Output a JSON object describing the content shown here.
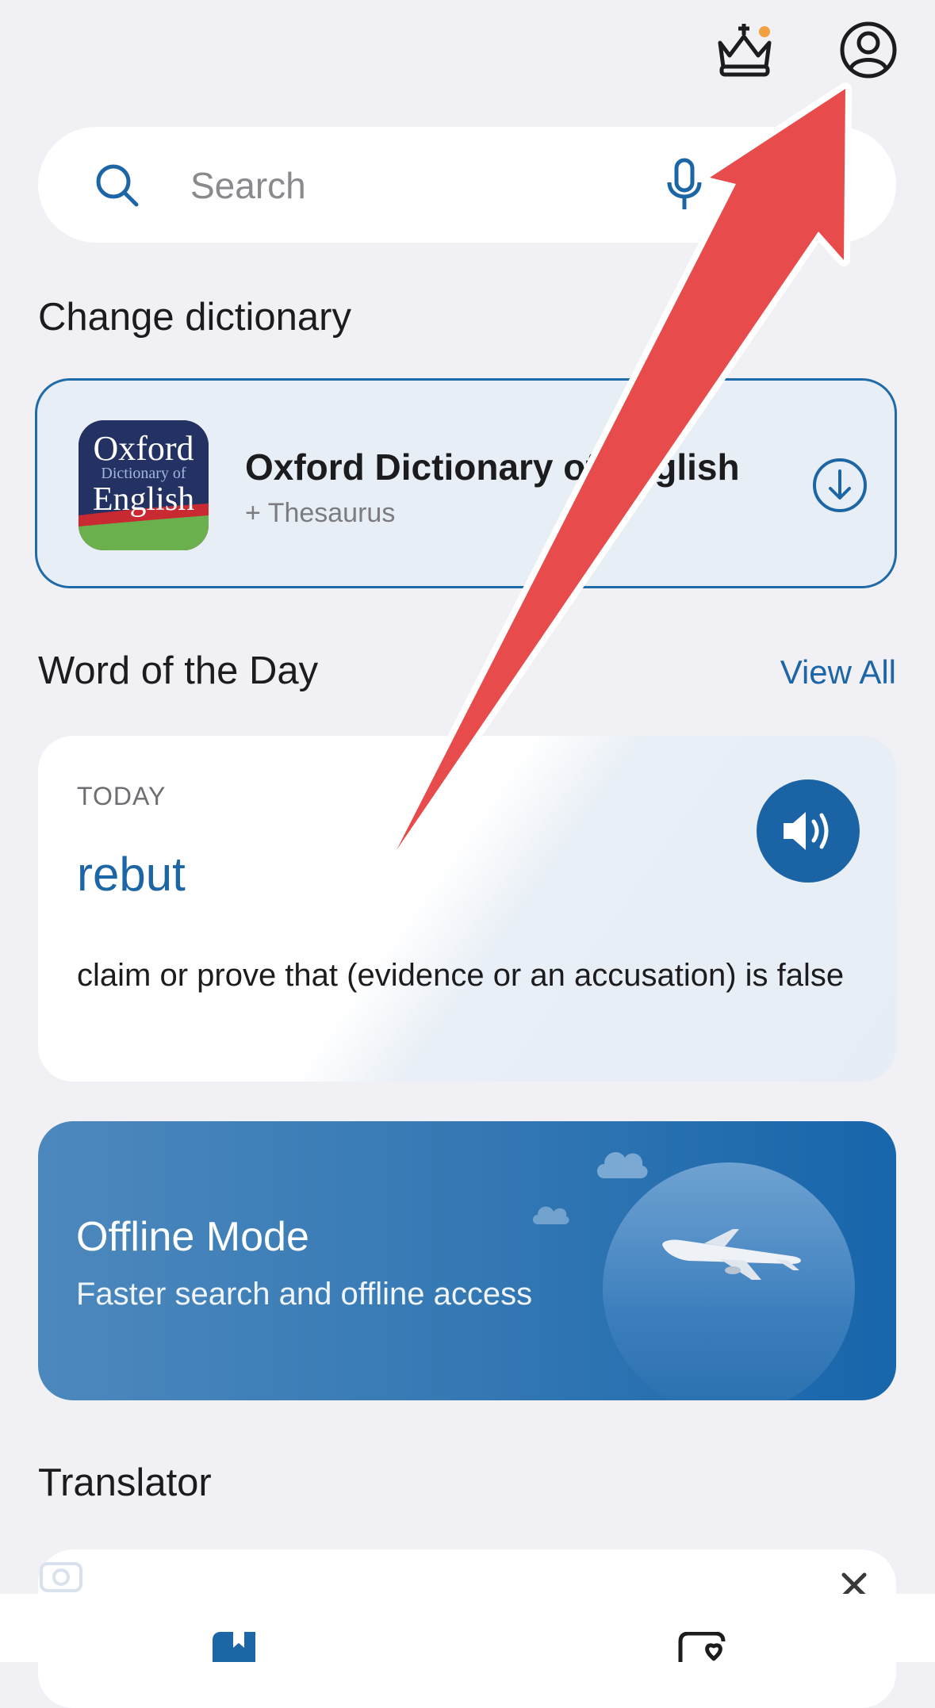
{
  "header": {
    "premium_icon": "crown-icon",
    "profile_icon": "person-circle-icon",
    "accent_color": "#f3a140"
  },
  "search": {
    "placeholder": "Search",
    "search_icon": "magnifier-icon",
    "mic_icon": "microphone-icon"
  },
  "change_dictionary": {
    "heading": "Change dictionary",
    "dictionary": {
      "name": "Oxford Dictionary of English",
      "subtitle": "+ Thesaurus",
      "logo_line1": "Oxford",
      "logo_line2": "Dictionary of",
      "logo_line3": "English",
      "download_icon": "download-circle-icon"
    }
  },
  "word_of_day": {
    "heading": "Word of the Day",
    "view_all": "View All",
    "label": "TODAY",
    "word": "rebut",
    "definition": "claim or prove that (evidence or an accusation) is false",
    "speaker_icon": "speaker-icon"
  },
  "offline_mode": {
    "title": "Offline Mode",
    "subtitle": "Faster search and offline access",
    "illustration": "airplane-illustration"
  },
  "translator": {
    "heading": "Translator",
    "close_icon": "close-icon"
  },
  "tabbar": {
    "items": [
      {
        "icon": "dictionary-book-icon"
      },
      {
        "icon": "favorites-icon"
      }
    ]
  },
  "colors": {
    "brand_blue": "#1a64a6",
    "annotation_arrow": "#e84b4b",
    "background": "#f1f0f5"
  }
}
